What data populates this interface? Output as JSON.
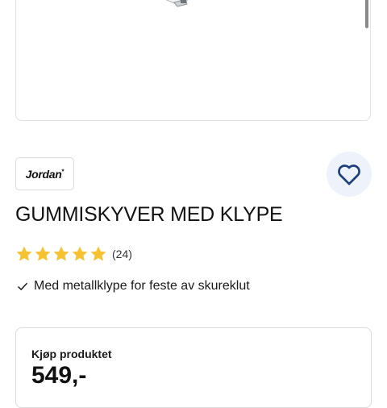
{
  "brand": {
    "logo_text": "Jordan",
    "logo_mark": "*"
  },
  "product": {
    "title": "GUMMISKYVER MED KLYPE",
    "rating_stars": 5,
    "rating_max": 5,
    "review_count": "(24)",
    "feature_text": "Med metallklype for feste av skureklut"
  },
  "purchase": {
    "heading": "Kjøp produktet",
    "price": "549,-"
  },
  "icons": {
    "favorite": "heart-outline-icon",
    "feature_bullet": "checkmark-icon",
    "rating": "star-icon"
  },
  "colors": {
    "star": "#f7c231",
    "heart": "#1e3f7a",
    "favorite_bg": "#eef3fb",
    "border": "#dcdcdc"
  }
}
